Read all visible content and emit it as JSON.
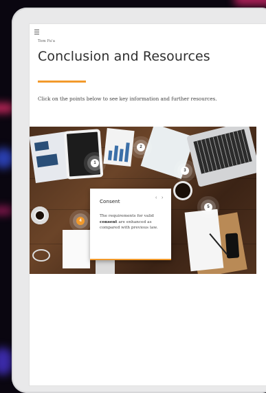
{
  "header": {
    "breadcrumb": "Tem Fa'a",
    "title": "Conclusion and Resources"
  },
  "instruction": "Click on the points below to see key information and further resources.",
  "hotspots": [
    {
      "label": "1"
    },
    {
      "label": "2"
    },
    {
      "label": "3"
    },
    {
      "label": "4"
    },
    {
      "label": "5"
    }
  ],
  "popup": {
    "title": "Consent",
    "text_before": "The requirements for valid",
    "text_bold": "consent",
    "text_after": "are enhanced as compared with previous law.",
    "prev_glyph": "‹",
    "next_glyph": "›"
  },
  "colors": {
    "accent": "#f29a2c",
    "title": "#2e2e2e"
  },
  "icons": {
    "menu": "hamburger-menu-icon"
  }
}
